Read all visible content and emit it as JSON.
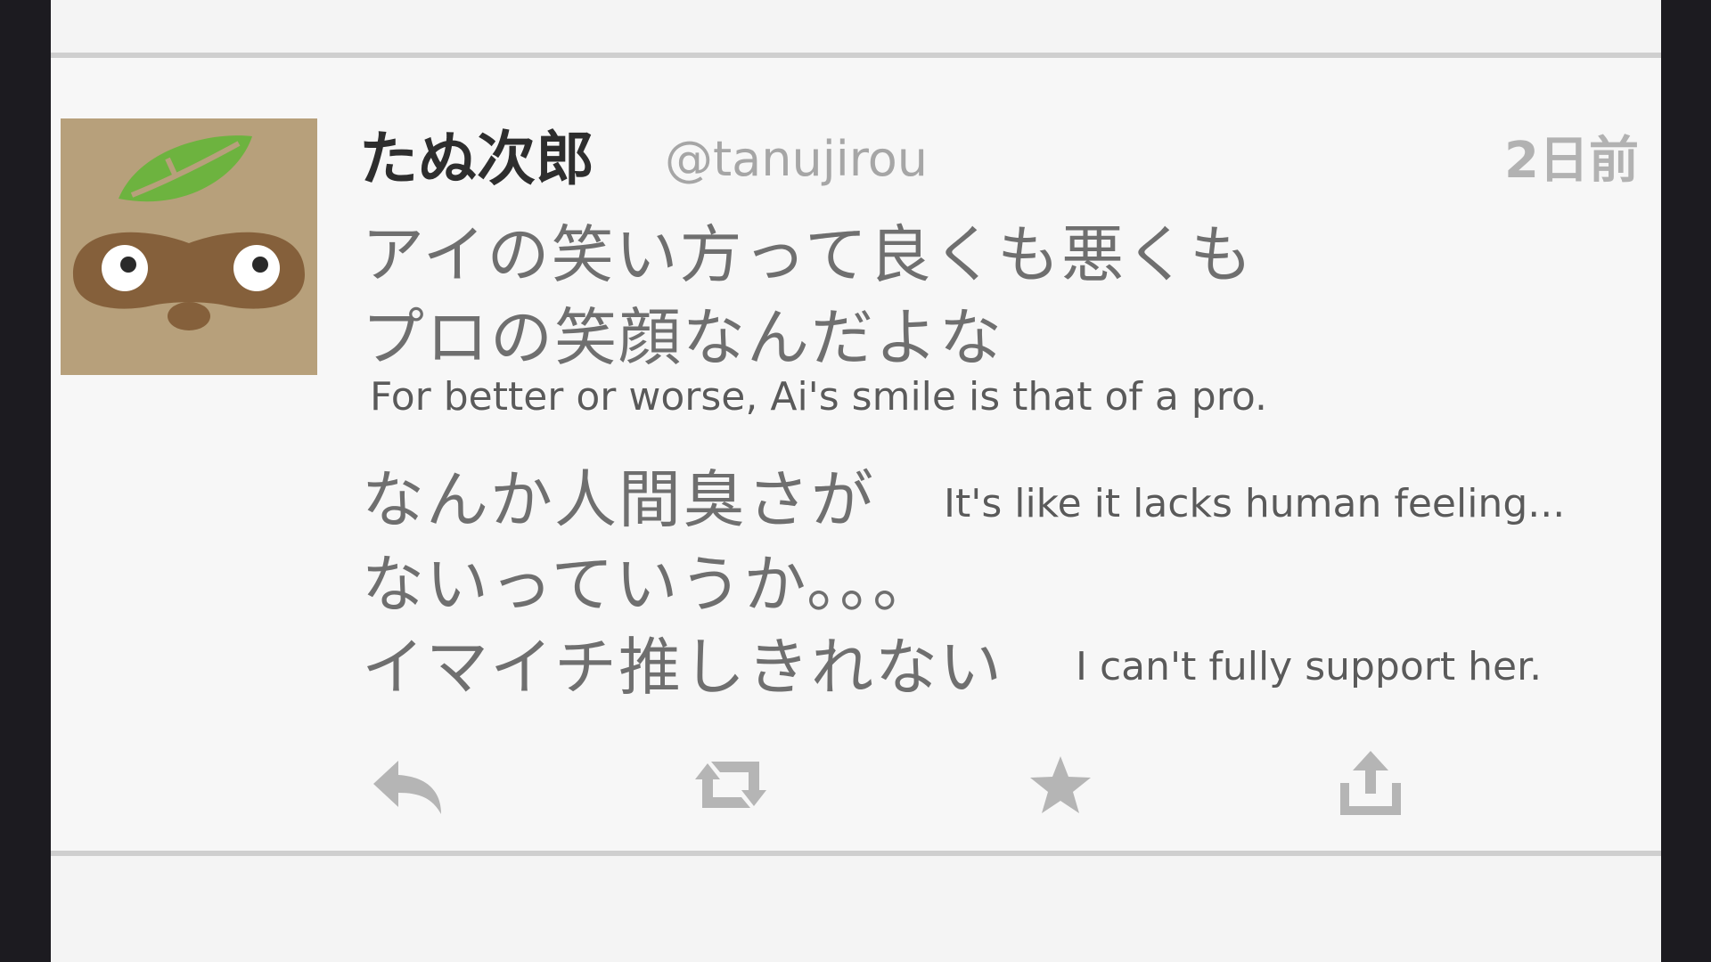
{
  "tweet": {
    "user_name": "たぬ次郎",
    "handle": "@tanujirou",
    "timestamp": "2日前",
    "lines": [
      "アイの笑い方って良くも悪くも",
      "プロの笑顔なんだよな",
      "なんか人間臭さが",
      "ないっていうか。。。",
      "イマイチ推しきれない"
    ]
  },
  "subtitles": {
    "line1": "For better or worse, Ai's smile is that of a pro.",
    "line2": "It's like it lacks human feeling...",
    "line3": "I can't fully support her."
  },
  "actions": {
    "icons": [
      "reply-icon",
      "retweet-icon",
      "favorite-star-icon",
      "share-icon"
    ]
  },
  "colors": {
    "avatar_bg": "#b7a07b",
    "leaf_green": "#6db33f",
    "icon_gray": "#b5b5b5"
  }
}
